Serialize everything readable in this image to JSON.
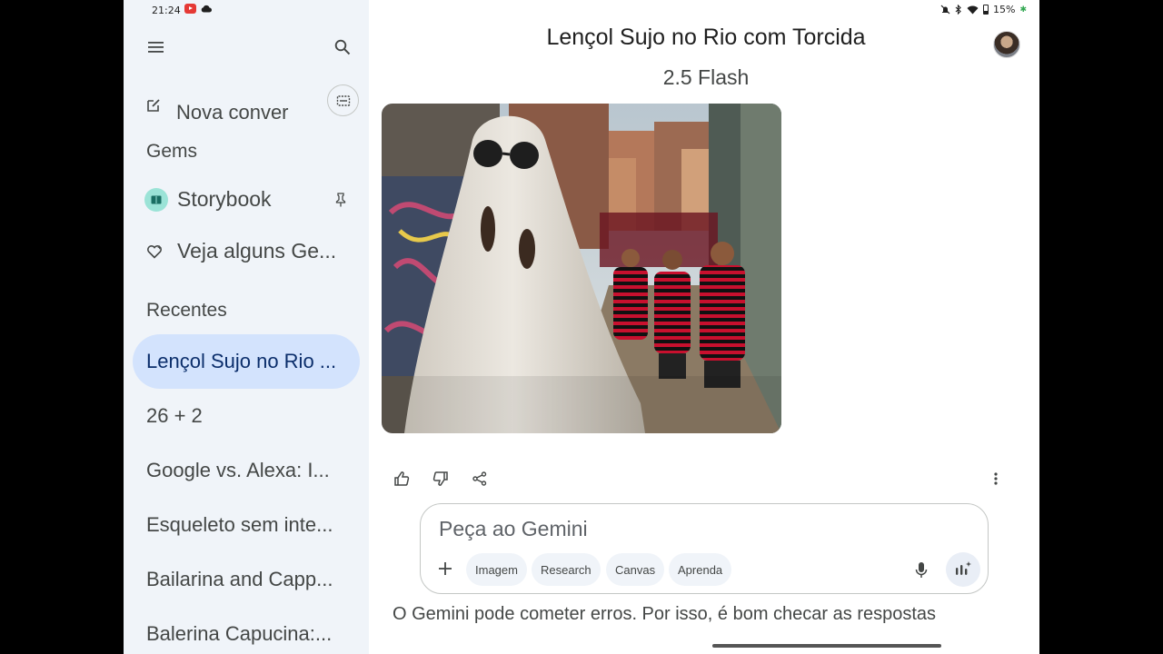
{
  "status_bar": {
    "time": "21:24",
    "battery": "15%"
  },
  "sidebar": {
    "new_chat_label": "Nova conver",
    "gems_label": "Gems",
    "gems": [
      {
        "label": "Storybook",
        "icon": "book-icon"
      },
      {
        "label": "Veja alguns Ge...",
        "icon": "gem-icon"
      }
    ],
    "recent_label": "Recentes",
    "recent": [
      {
        "label": "Lençol Sujo no Rio ...",
        "active": true
      },
      {
        "label": "26 + 2",
        "active": false
      },
      {
        "label": "Google vs. Alexa: I...",
        "active": false
      },
      {
        "label": "Esqueleto sem inte...",
        "active": false
      },
      {
        "label": "Bailarina and Capp...",
        "active": false
      },
      {
        "label": "Balerina Capucina:...",
        "active": false
      }
    ]
  },
  "main": {
    "title": "Lençol Sujo no Rio com Torcida",
    "model": "2.5 Flash",
    "input_placeholder": "Peça ao Gemini",
    "chips": [
      "Imagem",
      "Research",
      "Canvas",
      "Aprenda"
    ],
    "disclaimer": "O Gemini pode cometer erros. Por isso, é bom checar as respostas"
  },
  "colors": {
    "sidebar_bg": "#f0f4f9",
    "active_item_bg": "#d3e3fd",
    "fan_jersey_red": "#c8102e"
  }
}
